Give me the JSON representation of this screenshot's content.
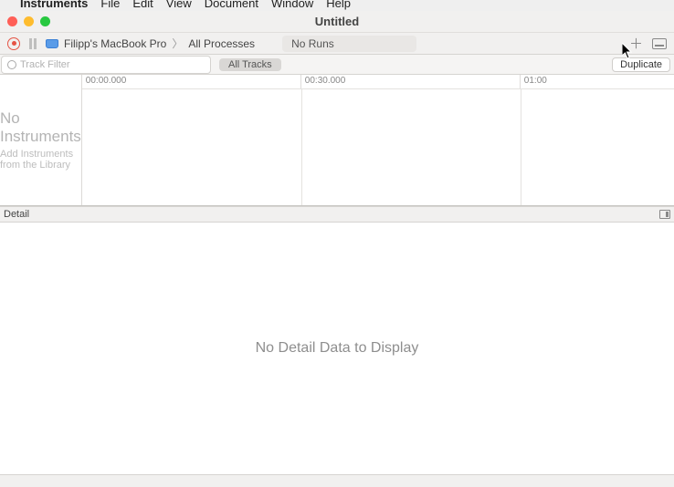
{
  "menubar": {
    "apple": "",
    "app": "Instruments",
    "items": [
      "File",
      "Edit",
      "View",
      "Document",
      "Window",
      "Help"
    ]
  },
  "window": {
    "title": "Untitled"
  },
  "toolbar": {
    "target_device": "Filipp's MacBook Pro",
    "target_process": "All Processes",
    "runs": "No Runs"
  },
  "filter": {
    "placeholder": "Track Filter",
    "scope_label": "All Tracks",
    "duplicate_label": "Duplicate"
  },
  "timeline": {
    "no_instruments": "No Instruments",
    "add_hint": "Add Instruments from the Library",
    "ruler": [
      "00:00.000",
      "00:30.000",
      "01:00"
    ]
  },
  "detail": {
    "header": "Detail",
    "empty": "No Detail Data to Display"
  }
}
